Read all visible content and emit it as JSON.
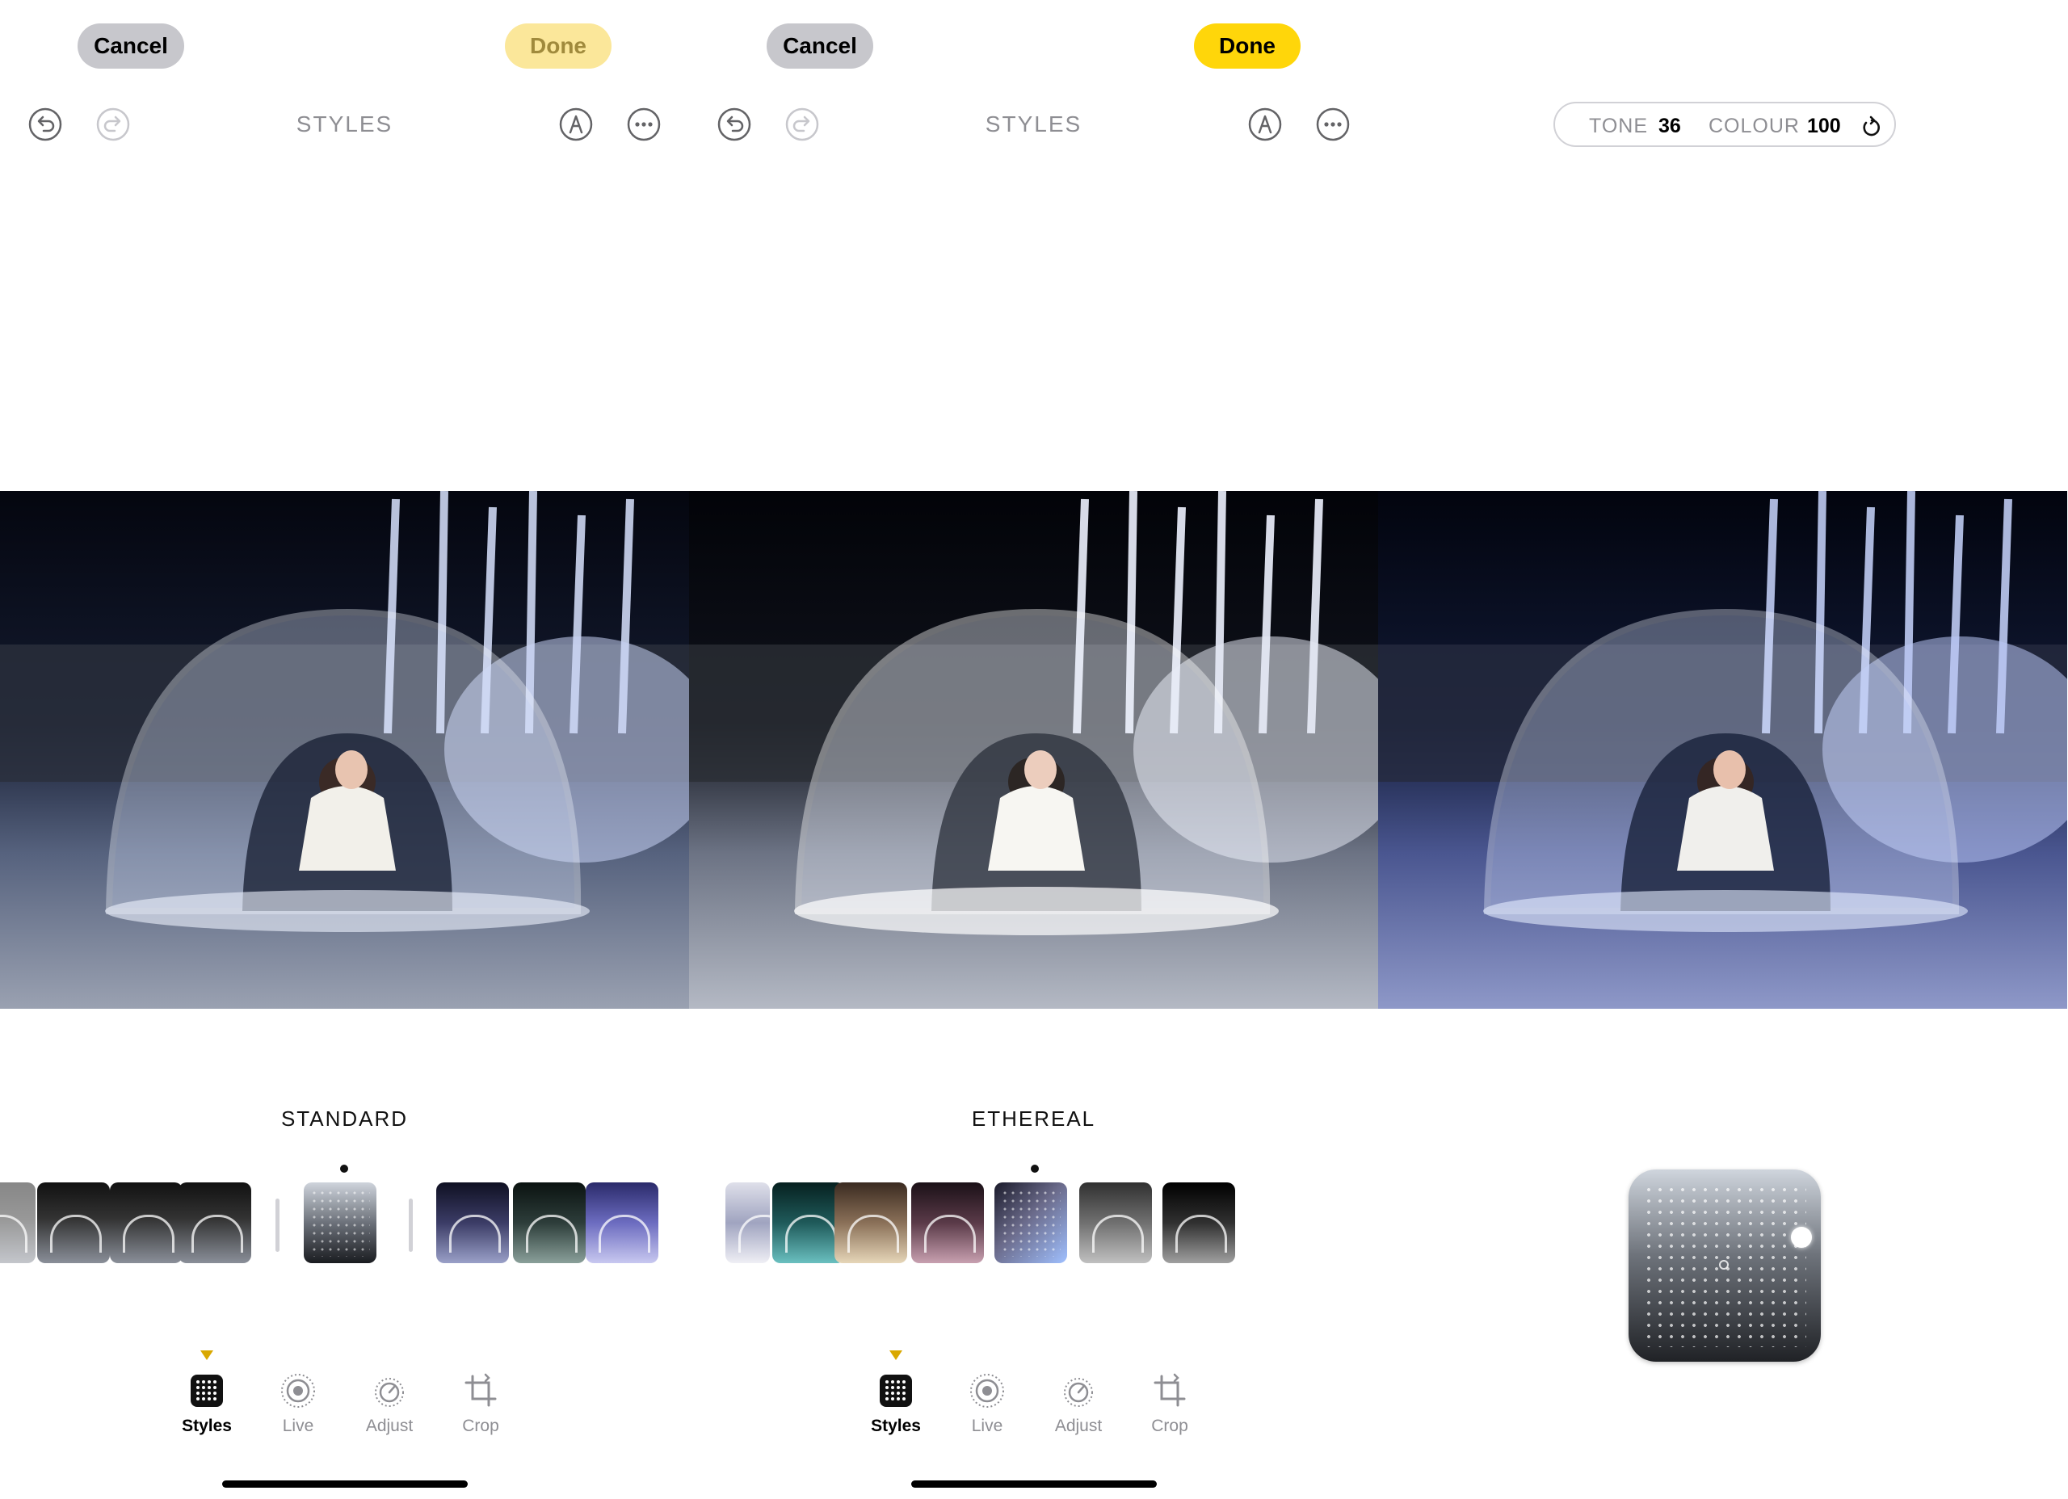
{
  "panels": [
    {
      "cancel_label": "Cancel",
      "done_label": "Done",
      "title": "STYLES",
      "style_name": "STANDARD",
      "tabs": [
        {
          "label": "Styles",
          "icon": "styles-grid-icon"
        },
        {
          "label": "Live",
          "icon": "live-photo-icon"
        },
        {
          "label": "Adjust",
          "icon": "adjust-dial-icon"
        },
        {
          "label": "Crop",
          "icon": "crop-icon"
        }
      ]
    },
    {
      "cancel_label": "Cancel",
      "done_label": "Done",
      "title": "STYLES",
      "style_name": "ETHEREAL",
      "tabs": [
        {
          "label": "Styles",
          "icon": "styles-grid-icon"
        },
        {
          "label": "Live",
          "icon": "live-photo-icon"
        },
        {
          "label": "Adjust",
          "icon": "adjust-dial-icon"
        },
        {
          "label": "Crop",
          "icon": "crop-icon"
        }
      ]
    },
    {
      "tone_label": "TONE",
      "tone_value": "36",
      "colour_label": "COLOUR",
      "colour_value": "100"
    }
  ],
  "colors": {
    "accent_yellow": "#ffd60a",
    "accent_yellow_dim": "#fbe79a",
    "cancel_gray": "#c7c7cc",
    "secondary_text": "#8e8e93",
    "tab_marker": "#d9a800"
  }
}
